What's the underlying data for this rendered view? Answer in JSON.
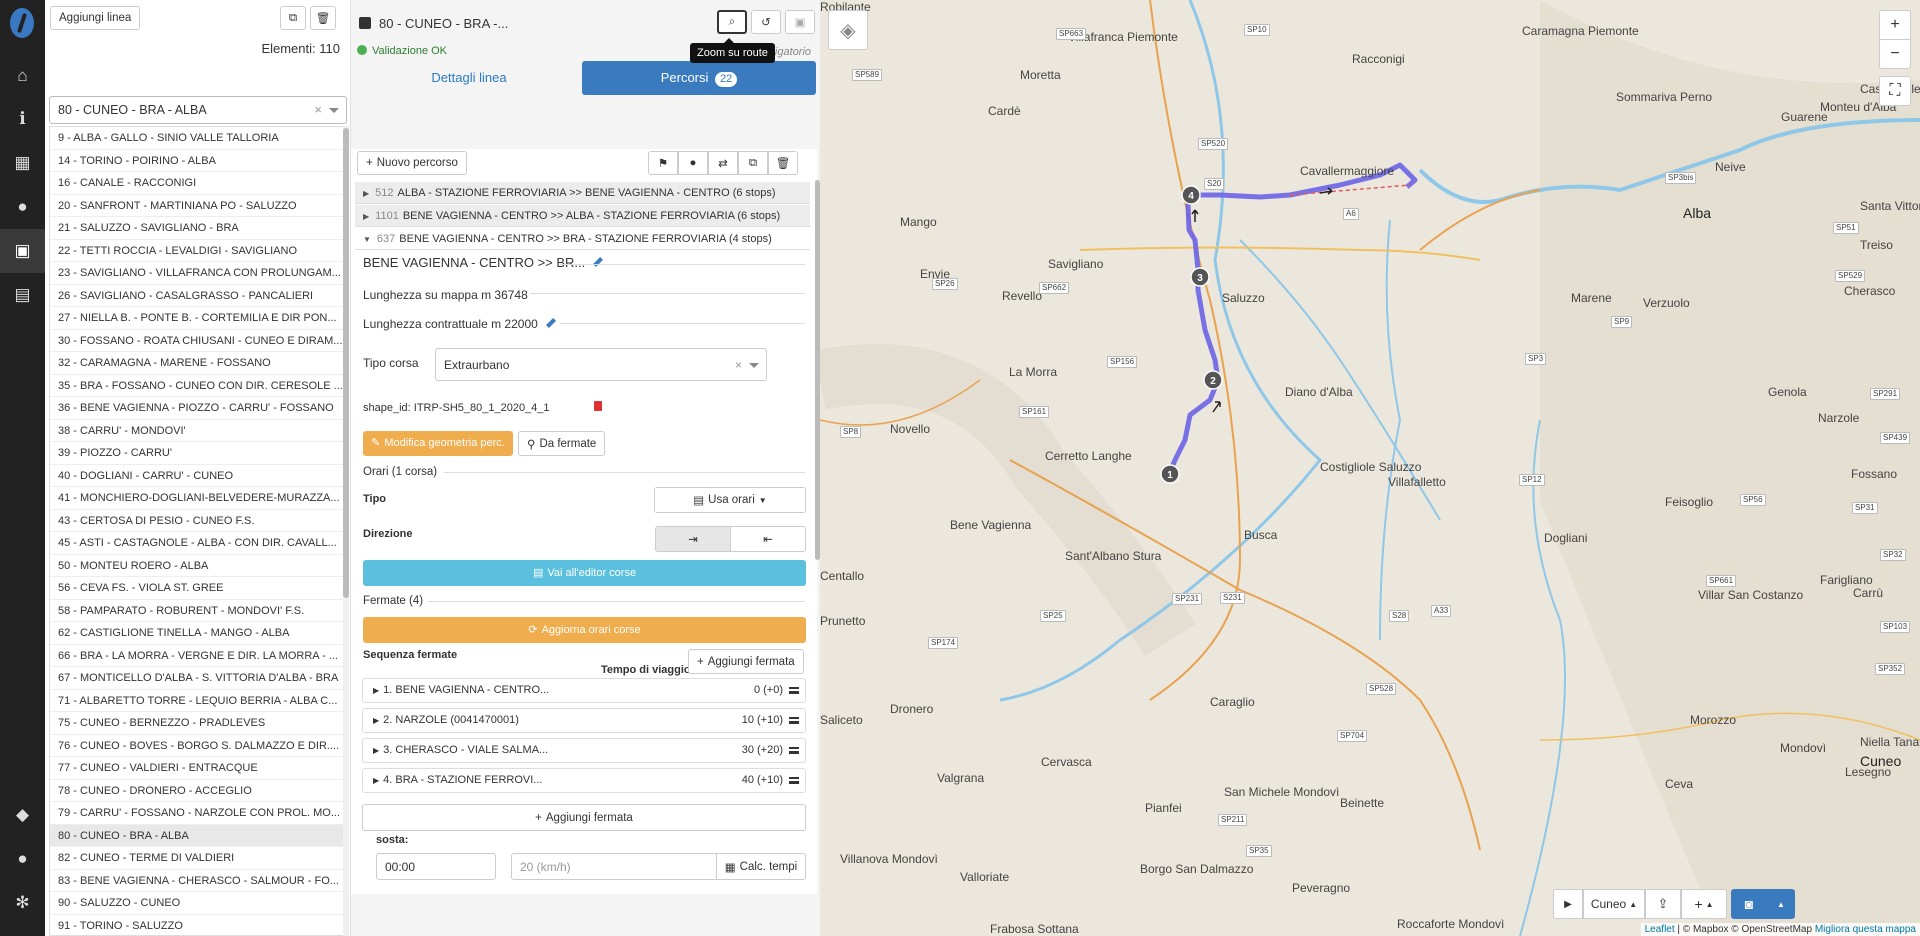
{
  "sidebar": {
    "logo": "app-logo",
    "icons": [
      "home-icon",
      "info-icon",
      "building-icon",
      "map-marker-icon",
      "bus-icon",
      "calendar-icon",
      "bell-icon",
      "user-icon",
      "gear-icon"
    ]
  },
  "lines": {
    "add_label": "Aggiungi linea",
    "elements_label": "Elementi:",
    "elements_count": "110",
    "selected": "80 - CUNEO - BRA - ALBA",
    "items": [
      "9 - ALBA - GALLO - SINIO VALLE TALLORIA",
      "14 - TORINO - POIRINO - ALBA",
      "16 - CANALE - RACCONIGI",
      "20 - SANFRONT - MARTINIANA PO - SALUZZO",
      "21 - SALUZZO - SAVIGLIANO - BRA",
      "22 - TETTI ROCCIA - LEVALDIGI - SAVIGLIANO",
      "23 - SAVIGLIANO - VILLAFRANCA CON PROLUNGAM...",
      "26 - SAVIGLIANO - CASALGRASSO - PANCALIERI",
      "27 - NIELLA B. - PONTE B. - CORTEMILIA E DIR PON...",
      "30 - FOSSANO - ROATA CHIUSANI - CUNEO E DIRAM...",
      "32 - CARAMAGNA - MARENE - FOSSANO",
      "35 - BRA - FOSSANO - CUNEO CON DIR. CERESOLE ...",
      "36 - BENE VAGIENNA - PIOZZO - CARRU' - FOSSANO",
      "38 - CARRU' - MONDOVI'",
      "39 - PIOZZO - CARRU'",
      "40 - DOGLIANI - CARRU' - CUNEO",
      "41 - MONCHIERO-DOGLIANI-BELVEDERE-MURAZZA...",
      "43 - CERTOSA DI PESIO - CUNEO F.S.",
      "45 - ASTI - CASTAGNOLE - ALBA - CON DIR. CAVALL...",
      "50 - MONTEU ROERO - ALBA",
      "56 - CEVA FS. - VIOLA ST. GREE",
      "58 - PAMPARATO - ROBURENT - MONDOVI' F.S.",
      "62 - CASTIGLIONE TINELLA - MANGO - ALBA",
      "66 - BRA - LA MORRA - VERGNE E DIR. LA MORRA - ...",
      "67 - MONTICELLO D'ALBA - S. VITTORIA D'ALBA - BRA",
      "71 - ALBARETTO TORRE - LEQUIO BERRIA - ALBA C...",
      "75 - CUNEO - BERNEZZO - PRADLEVES",
      "76 - CUNEO - BOVES - BORGO S. DALMAZZO E DIR....",
      "77 - CUNEO - VALDIERI - ENTRACQUE",
      "78 - CUNEO - DRONERO - ACCEGLIO",
      "79 - CARRU' - FOSSANO - NARZOLE CON PROL. MO...",
      "80 - CUNEO - BRA - ALBA",
      "82 - CUNEO - TERME DI VALDIERI",
      "83 - BENE VAGIENNA - CHERASCO - SALMOUR - FO...",
      "90 - SALUZZO - CUNEO",
      "91 - TORINO - SALUZZO"
    ]
  },
  "details": {
    "title": "80 - CUNEO - BRA -...",
    "validation": "Validazione OK",
    "obligatory": "obbligatorio",
    "tooltip": "Zoom su route",
    "tab_details": "Dettagli linea",
    "tab_routes": "Percorsi",
    "routes_count": "22",
    "new_route": "Nuovo percorso",
    "routes": [
      {
        "id": "512",
        "name": "ALBA - STAZIONE FERROVIARIA >> BENE VAGIENNA - CENTRO (6 stops)"
      },
      {
        "id": "1101",
        "name": "BENE VAGIENNA - CENTRO >> ALBA - STAZIONE FERROVIARIA (6 stops)"
      },
      {
        "id": "637",
        "name": "BENE VAGIENNA - CENTRO >> BRA - STAZIONE FERROVIARIA (4 stops)"
      }
    ],
    "route_name": "BENE VAGIENNA - CENTRO >> BR...",
    "map_length": "Lunghezza su mappa m 36748",
    "contract_length": "Lunghezza contrattuale m 22000",
    "trip_type_label": "Tipo corsa",
    "trip_type_value": "Extraurbano",
    "shape_id": "shape_id: ITRP-SH5_80_1_2020_4_1",
    "edit_geometry": "Modifica geometria perc.",
    "from_stops": "Da fermate",
    "schedules": "Orari (1 corsa)",
    "type_label": "Tipo",
    "use_schedules": "Usa orari",
    "direction_label": "Direzione",
    "editor_button": "Vai all'editor corse",
    "stops_header": "Fermate (4)",
    "update_button": "Aggiorna orari corse",
    "sequence_label": "Sequenza fermate",
    "travel_time_label": "Tempo di viaggio",
    "add_stop": "Aggiungi fermata",
    "stops": [
      {
        "name": "1. BENE VAGIENNA - CENTRO...",
        "time": "0 (+0)"
      },
      {
        "name": "2. NARZOLE (0041470001)",
        "time": "10 (+10)"
      },
      {
        "name": "3. CHERASCO - VIALE SALMA...",
        "time": "30 (+20)"
      },
      {
        "name": "4. BRA - STAZIONE FERROVI...",
        "time": "40 (+10)"
      }
    ],
    "stop_label": "sosta:",
    "stop_time": "00:00",
    "speed_placeholder": "20 (km/h)",
    "calc_times": "Calc. tempi"
  },
  "map": {
    "towns": [
      "Villafranca Piemonte",
      "Racconigi",
      "Caramagna Piemonte",
      "Moretta",
      "Cardè",
      "Sommariva Perno",
      "Cavallermaggiore",
      "Monteu d'Alba",
      "Guarene",
      "Castagnole delle Lanze",
      "Neive",
      "Santa Vittoria d'Alba",
      "Alba",
      "Treiso",
      "Mango",
      "Envie",
      "Revello",
      "Saluzzo",
      "Savigliano",
      "Marene",
      "Cherasco",
      "La Morra",
      "Diano d'Alba",
      "Verzuolo",
      "Genola",
      "Narzole",
      "Novello",
      "Cerretto Langhe",
      "Costigliole Saluzzo",
      "Villafalletto",
      "Fossano",
      "Bene Vagienna",
      "Feisoglio",
      "Busca",
      "Dogliani",
      "Sant'Albano Stura",
      "Farigliano",
      "Centallo",
      "Villar San Costanzo",
      "Carrù",
      "Prunetto",
      "Dronero",
      "Caraglio",
      "Morozzo",
      "Mondovì",
      "Niella Tanaro",
      "Saliceto",
      "Valgrana",
      "Cervasca",
      "Cuneo",
      "Lesegno",
      "Ceva",
      "San Michele Mondovì",
      "Pianfei",
      "Beinette",
      "Villanova Mondovì",
      "Valloriate",
      "Borgo San Dalmazzo",
      "Peveragno",
      "Roccaforte Mondovì",
      "Frabosa Sottana",
      "Robilante"
    ],
    "roads": [
      "SP10",
      "SP663",
      "SP589",
      "SP520",
      "SP662",
      "SP26",
      "SP161",
      "SP156",
      "SP8",
      "SP231",
      "SP25",
      "SP174",
      "SP211",
      "SP528",
      "SP704",
      "SP35",
      "SP12",
      "SP3",
      "SP9",
      "SP3bis",
      "SP51",
      "SP529",
      "SP291",
      "SP439",
      "SP56",
      "SP31",
      "SP32",
      "SP661",
      "SP103",
      "SP352",
      "A33",
      "A6",
      "S20",
      "S231",
      "S28"
    ],
    "zoom_in": "+",
    "zoom_out": "−",
    "region": "Cuneo",
    "attribution_leaflet": "Leaflet",
    "attribution_rest": "| © Mapbox © OpenStreetMap",
    "attribution_improve": "Migliora questa mappa"
  }
}
